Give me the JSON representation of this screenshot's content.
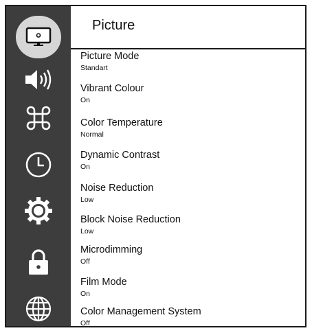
{
  "header": {
    "title": "Picture"
  },
  "sidebar": {
    "icons": [
      "tv-picture-icon",
      "speaker-icon",
      "command-icon",
      "clock-icon",
      "gear-icon",
      "lock-icon",
      "globe-icon"
    ]
  },
  "settings": [
    {
      "label": "Picture Mode",
      "value": "Standart"
    },
    {
      "label": "Vibrant Colour",
      "value": "On"
    },
    {
      "label": "Color Temperature",
      "value": "Normal"
    },
    {
      "label": "Dynamic Contrast",
      "value": "On"
    },
    {
      "label": "Noise Reduction",
      "value": "Low"
    },
    {
      "label": "Block Noise Reduction",
      "value": "Low"
    },
    {
      "label": "Microdimming",
      "value": "Off"
    },
    {
      "label": "Film Mode",
      "value": "On"
    },
    {
      "label": "Color Management System",
      "value": "Off"
    }
  ],
  "colors": {
    "rail": "#3d3d3d",
    "active_bubble": "#d6d6d6",
    "icon": "#ffffff"
  }
}
